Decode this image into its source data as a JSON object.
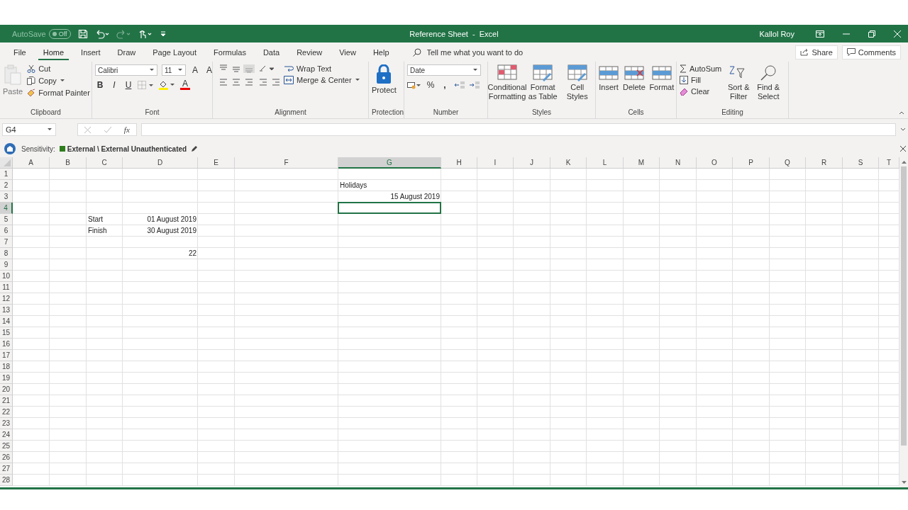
{
  "title_bar": {
    "autosave": {
      "label": "AutoSave",
      "state": "Off",
      "on": false
    },
    "title": "Reference Sheet  -  Excel",
    "user": "Kallol Roy"
  },
  "tabs": [
    {
      "label": "File",
      "selected": false
    },
    {
      "label": "Home",
      "selected": true
    },
    {
      "label": "Insert",
      "selected": false
    },
    {
      "label": "Draw",
      "selected": false
    },
    {
      "label": "Page Layout",
      "selected": false
    },
    {
      "label": "Formulas",
      "selected": false
    },
    {
      "label": "Data",
      "selected": false
    },
    {
      "label": "Review",
      "selected": false
    },
    {
      "label": "View",
      "selected": false
    },
    {
      "label": "Help",
      "selected": false
    }
  ],
  "tell_me": {
    "placeholder": "Tell me what you want to do"
  },
  "share": "Share",
  "comments": "Comments",
  "ribbon": {
    "clipboard": {
      "label": "Clipboard",
      "paste": {
        "label": "Paste",
        "disabled": true
      },
      "cut": "Cut",
      "copy": "Copy",
      "format_painter": "Format Painter"
    },
    "font": {
      "label": "Font",
      "family": "Calibri",
      "size": "11",
      "grow": "A",
      "shrink": "A",
      "bold": "B",
      "italic": "I",
      "underline": "U",
      "font_color": "A"
    },
    "alignment": {
      "label": "Alignment",
      "wrap_text": "Wrap Text",
      "merge": "Merge & Center"
    },
    "protection": {
      "label": "Protection",
      "protect": "Protect"
    },
    "number": {
      "label": "Number",
      "format": "Date",
      "percent": "%",
      "comma": ","
    },
    "styles": {
      "label": "Styles",
      "buttons": [
        "Conditional Formatting",
        "Format as Table",
        "Cell Styles"
      ]
    },
    "cells": {
      "label": "Cells",
      "buttons": [
        "Insert",
        "Delete",
        "Format"
      ]
    },
    "editing": {
      "label": "Editing",
      "autosum": "AutoSum",
      "fill": "Fill",
      "clear": "Clear",
      "sort": "Sort & Filter",
      "find": "Find & Select"
    }
  },
  "formula_bar": {
    "name_box": "G4",
    "fx": "fx"
  },
  "sensitivity": {
    "label": "Sensitivity:",
    "value": "External \\ External Unauthenticated",
    "color": "#2e7d1c"
  },
  "sheet": {
    "columns": [
      {
        "label": "A",
        "selected": false
      },
      {
        "label": "B",
        "selected": false
      },
      {
        "label": "C",
        "selected": false
      },
      {
        "label": "D",
        "selected": false
      },
      {
        "label": "E",
        "selected": false
      },
      {
        "label": "F",
        "selected": false
      },
      {
        "label": "G",
        "selected": true
      },
      {
        "label": "H",
        "selected": false
      },
      {
        "label": "I",
        "selected": false
      },
      {
        "label": "J",
        "selected": false
      },
      {
        "label": "K",
        "selected": false
      },
      {
        "label": "L",
        "selected": false
      },
      {
        "label": "M",
        "selected": false
      },
      {
        "label": "N",
        "selected": false
      },
      {
        "label": "O",
        "selected": false
      },
      {
        "label": "P",
        "selected": false
      },
      {
        "label": "Q",
        "selected": false
      },
      {
        "label": "R",
        "selected": false
      },
      {
        "label": "S",
        "selected": false
      },
      {
        "label": "T",
        "selected": false
      }
    ],
    "rows": [
      {
        "label": "1",
        "selected": false
      },
      {
        "label": "2",
        "selected": false,
        "cells": [
          null,
          null,
          null,
          null,
          null,
          null,
          {
            "text": "Holidays",
            "kind": "text"
          }
        ]
      },
      {
        "label": "3",
        "selected": false,
        "cells": [
          null,
          null,
          null,
          null,
          null,
          null,
          {
            "text": "15 August 2019",
            "kind": "date"
          }
        ]
      },
      {
        "label": "4",
        "selected": true,
        "cells": [
          null,
          null,
          null,
          null,
          null,
          null,
          {
            "selected": true
          }
        ]
      },
      {
        "label": "5",
        "selected": false,
        "cells": [
          null,
          null,
          {
            "text": "Start",
            "kind": "text"
          },
          {
            "text": "01 August 2019",
            "kind": "date"
          }
        ]
      },
      {
        "label": "6",
        "selected": false,
        "cells": [
          null,
          null,
          {
            "text": "Finish",
            "kind": "text"
          },
          {
            "text": "30 August 2019",
            "kind": "date"
          }
        ]
      },
      {
        "label": "7",
        "selected": false
      },
      {
        "label": "8",
        "selected": false,
        "cells": [
          null,
          null,
          null,
          {
            "text": "22",
            "kind": "number"
          }
        ]
      },
      {
        "label": "9",
        "selected": false
      },
      {
        "label": "10",
        "selected": false
      },
      {
        "label": "11",
        "selected": false
      },
      {
        "label": "12",
        "selected": false
      },
      {
        "label": "13",
        "selected": false
      },
      {
        "label": "14",
        "selected": false
      },
      {
        "label": "15",
        "selected": false
      },
      {
        "label": "16",
        "selected": false
      },
      {
        "label": "17",
        "selected": false
      },
      {
        "label": "18",
        "selected": false
      },
      {
        "label": "19",
        "selected": false
      },
      {
        "label": "20",
        "selected": false
      },
      {
        "label": "21",
        "selected": false
      },
      {
        "label": "22",
        "selected": false
      },
      {
        "label": "23",
        "selected": false
      },
      {
        "label": "24",
        "selected": false
      },
      {
        "label": "25",
        "selected": false
      },
      {
        "label": "26",
        "selected": false
      },
      {
        "label": "27",
        "selected": false
      },
      {
        "label": "28",
        "selected": false
      }
    ]
  }
}
